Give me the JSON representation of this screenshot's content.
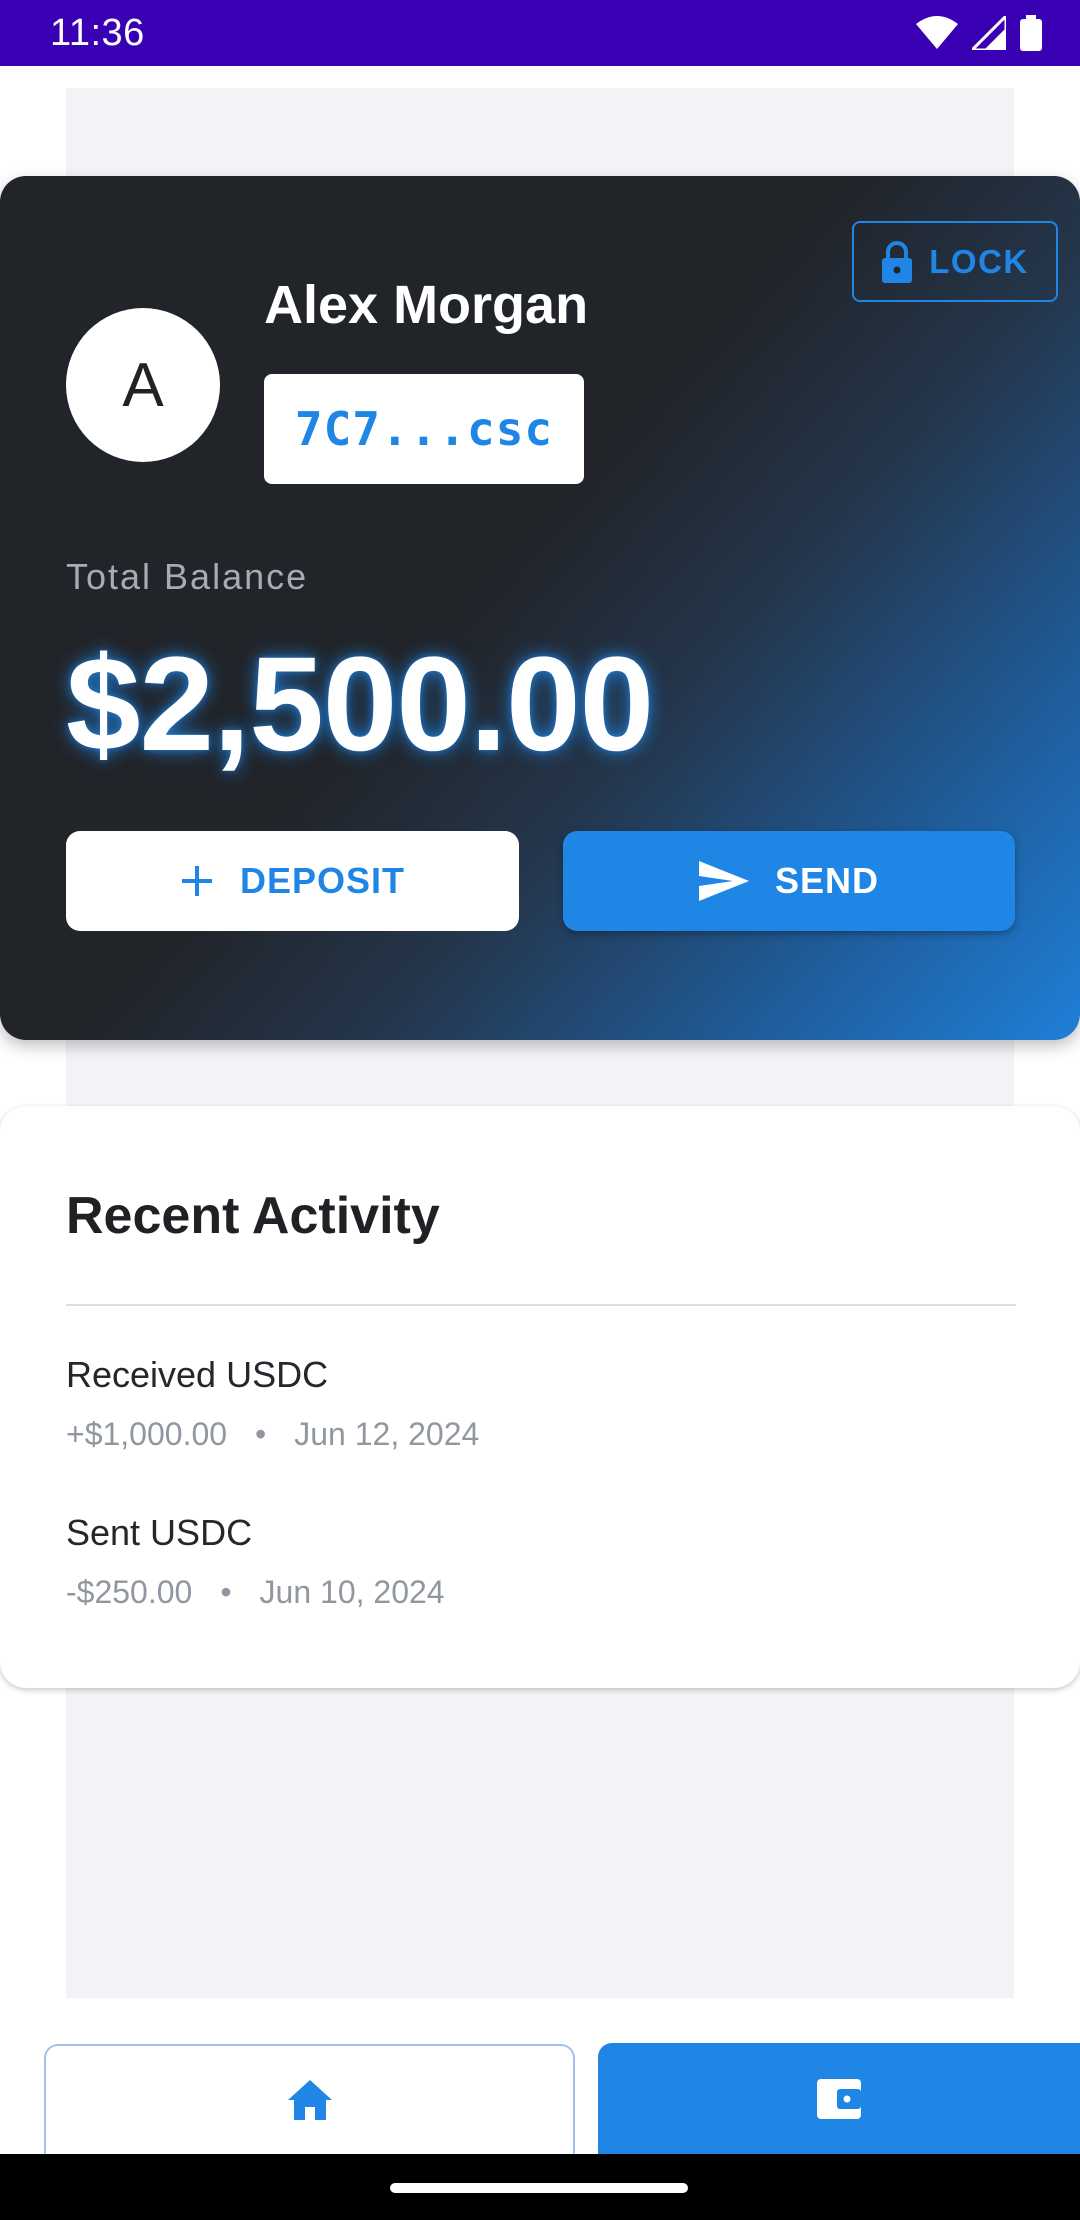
{
  "status_bar": {
    "time": "11:36"
  },
  "wallet": {
    "lock_label": "LOCK",
    "avatar_initial": "A",
    "user_name": "Alex Morgan",
    "address": "7C7...csc",
    "balance_label": "Total Balance",
    "balance": "$2,500.00",
    "deposit_label": "DEPOSIT",
    "send_label": "SEND"
  },
  "activity": {
    "title": "Recent Activity",
    "items": [
      {
        "title": "Received USDC",
        "amount": "+$1,000.00",
        "separator": "•",
        "date": "Jun 12, 2024"
      },
      {
        "title": "Sent USDC",
        "amount": "-$250.00",
        "separator": "•",
        "date": "Jun 10, 2024"
      }
    ]
  },
  "bottom_nav": {
    "items": [
      {
        "icon": "home-icon",
        "active": false
      },
      {
        "icon": "wallet-icon",
        "active": true
      }
    ]
  },
  "colors": {
    "accent": "#1f86e5",
    "status_bar": "#3a00b3",
    "card_dark": "#212429",
    "background": "#f3f4f7"
  }
}
